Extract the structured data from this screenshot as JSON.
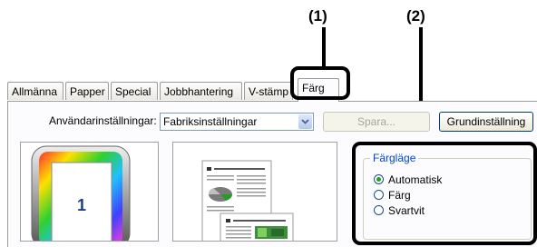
{
  "callouts": {
    "label1": "(1)",
    "label2": "(2)"
  },
  "tabs": [
    {
      "label": "Allmänna"
    },
    {
      "label": "Papper"
    },
    {
      "label": "Special"
    },
    {
      "label": "Jobbhantering"
    },
    {
      "label": "V-stämp"
    },
    {
      "label": "Färg",
      "selected": true
    }
  ],
  "user_settings": {
    "label": "Användarinställningar:",
    "value": "Fabriksinställningar",
    "save_button": "Spara...",
    "default_button": "Grundinställning"
  },
  "preview": {
    "page_number": "1"
  },
  "color_mode": {
    "title": "Färgläge",
    "options": [
      {
        "label": "Automatisk",
        "checked": true
      },
      {
        "label": "Färg",
        "checked": false
      },
      {
        "label": "Svartvit",
        "checked": false
      }
    ]
  },
  "colors": {
    "accent": "#0046d5",
    "radio_dot": "#21a121",
    "highlight": "#000000"
  }
}
